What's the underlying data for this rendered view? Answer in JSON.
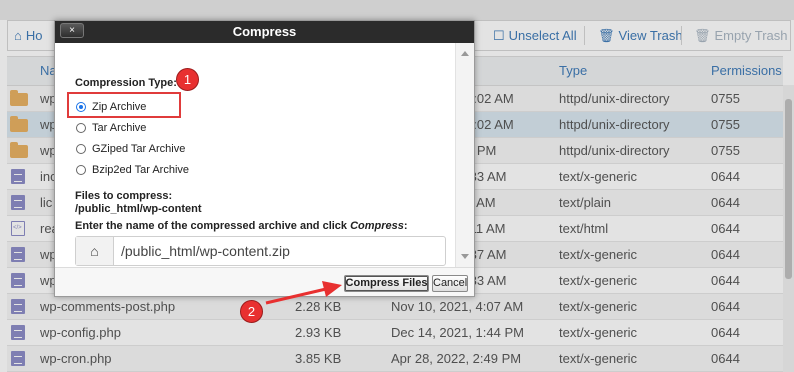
{
  "toolbar": {
    "home_label": "Ho",
    "unselect_all": "Unselect All",
    "view_trash": "View Trash",
    "empty_trash": "Empty Trash"
  },
  "table": {
    "columns": {
      "name": "Na",
      "type": "Type",
      "permissions": "Permissions"
    },
    "rows": [
      {
        "name": "wp",
        "size": "",
        "modified": "2:02 AM",
        "type": "httpd/unix-directory",
        "perm": "0755",
        "icon": "folder-icon"
      },
      {
        "name": "wp",
        "size": "",
        "modified": "2:02 AM",
        "type": "httpd/unix-directory",
        "perm": "0755",
        "icon": "folder-icon"
      },
      {
        "name": "wp",
        "size": "",
        "modified": "4 PM",
        "type": "httpd/unix-directory",
        "perm": "0755",
        "icon": "folder-icon"
      },
      {
        "name": "inc",
        "size": "",
        "modified": ":33 AM",
        "type": "text/x-generic",
        "perm": "0644",
        "icon": "file-icon"
      },
      {
        "name": "lic",
        "size": "",
        "modified": "5 AM",
        "type": "text/plain",
        "perm": "0644",
        "icon": "file-icon"
      },
      {
        "name": "rea",
        "size": "",
        "modified": ":11 AM",
        "type": "text/html",
        "perm": "0644",
        "icon": "html-file-icon"
      },
      {
        "name": "wp",
        "size": "",
        "modified": ":37 AM",
        "type": "text/x-generic",
        "perm": "0644",
        "icon": "file-icon"
      },
      {
        "name": "wp",
        "size": "",
        "modified": ":33 AM",
        "type": "text/x-generic",
        "perm": "0644",
        "icon": "file-icon"
      },
      {
        "name": "wp-comments-post.php",
        "size": "2.28 KB",
        "modified": "Nov 10, 2021, 4:07 AM",
        "type": "text/x-generic",
        "perm": "0644",
        "icon": "file-icon"
      },
      {
        "name": "wp-config.php",
        "size": "2.93 KB",
        "modified": "Dec 14, 2021, 1:44 PM",
        "type": "text/x-generic",
        "perm": "0644",
        "icon": "file-icon"
      },
      {
        "name": "wp-cron.php",
        "size": "3.85 KB",
        "modified": "Apr 28, 2022, 2:49 PM",
        "type": "text/x-generic",
        "perm": "0644",
        "icon": "file-icon"
      }
    ]
  },
  "dialog": {
    "title": "Compress",
    "close_label": "×",
    "compression_type_label": "Compression Type:",
    "options": [
      "Zip Archive",
      "Tar Archive",
      "GZiped Tar Archive",
      "Bzip2ed Tar Archive"
    ],
    "selected_option": "Zip Archive",
    "files_label": "Files to compress:",
    "files_path": "/public_html/wp-content",
    "enter_label_prefix": "Enter the name of the compressed archive and click ",
    "enter_label_em": "Compress",
    "enter_label_suffix": ":",
    "archive_name": "/public_html/wp-content.zip",
    "compress_button": "Compress Files",
    "cancel_button": "Cancel"
  },
  "annotations": {
    "step1": "1",
    "step2": "2",
    "color": "#e83030"
  },
  "colors": {
    "link": "#3d7ab8",
    "selected_row": "#d9e7f1",
    "title_bar": "#2b2b2b"
  }
}
